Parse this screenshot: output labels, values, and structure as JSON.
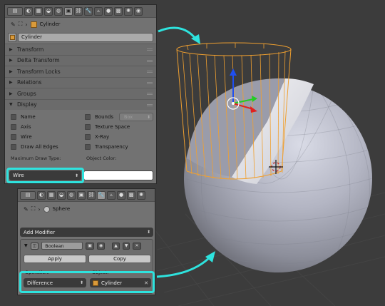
{
  "top_panel": {
    "breadcrumb_object": "Cylinder",
    "name_field": "Cylinder",
    "sections": [
      {
        "label": "Transform",
        "expanded": false
      },
      {
        "label": "Delta Transform",
        "expanded": false
      },
      {
        "label": "Transform Locks",
        "expanded": false
      },
      {
        "label": "Relations",
        "expanded": false
      },
      {
        "label": "Groups",
        "expanded": false
      },
      {
        "label": "Display",
        "expanded": true
      }
    ],
    "display": {
      "name": "Name",
      "axis": "Axis",
      "wire": "Wire",
      "draw_all_edges": "Draw All Edges",
      "bounds": "Bounds",
      "bounds_type": "Box",
      "texture_space": "Texture Space",
      "xray": "X-Ray",
      "transparency": "Transparency",
      "max_draw_type_label": "Maximum Draw Type:",
      "max_draw_type_value": "Wire",
      "object_color_label": "Object Color:",
      "object_color": "#ffffff"
    }
  },
  "bottom_panel": {
    "breadcrumb_object": "Sphere",
    "add_modifier": "Add Modifier",
    "modifier": {
      "name": "Boolean",
      "apply": "Apply",
      "copy": "Copy",
      "operation_label": "Operation:",
      "operation_value": "Difference",
      "object_label": "Object:",
      "object_value": "Cylinder"
    }
  },
  "icons": {
    "chevron": "›",
    "expand_right": "▶",
    "expand_down": "▼",
    "dropdown": "⬍",
    "clear": "✕",
    "pin": "📌"
  },
  "colors": {
    "highlight": "#2ee3de",
    "wire_orange": "#f0a030",
    "axis_blue": "#1f4ff0",
    "axis_green": "#22cc22",
    "axis_red": "#e02020"
  }
}
